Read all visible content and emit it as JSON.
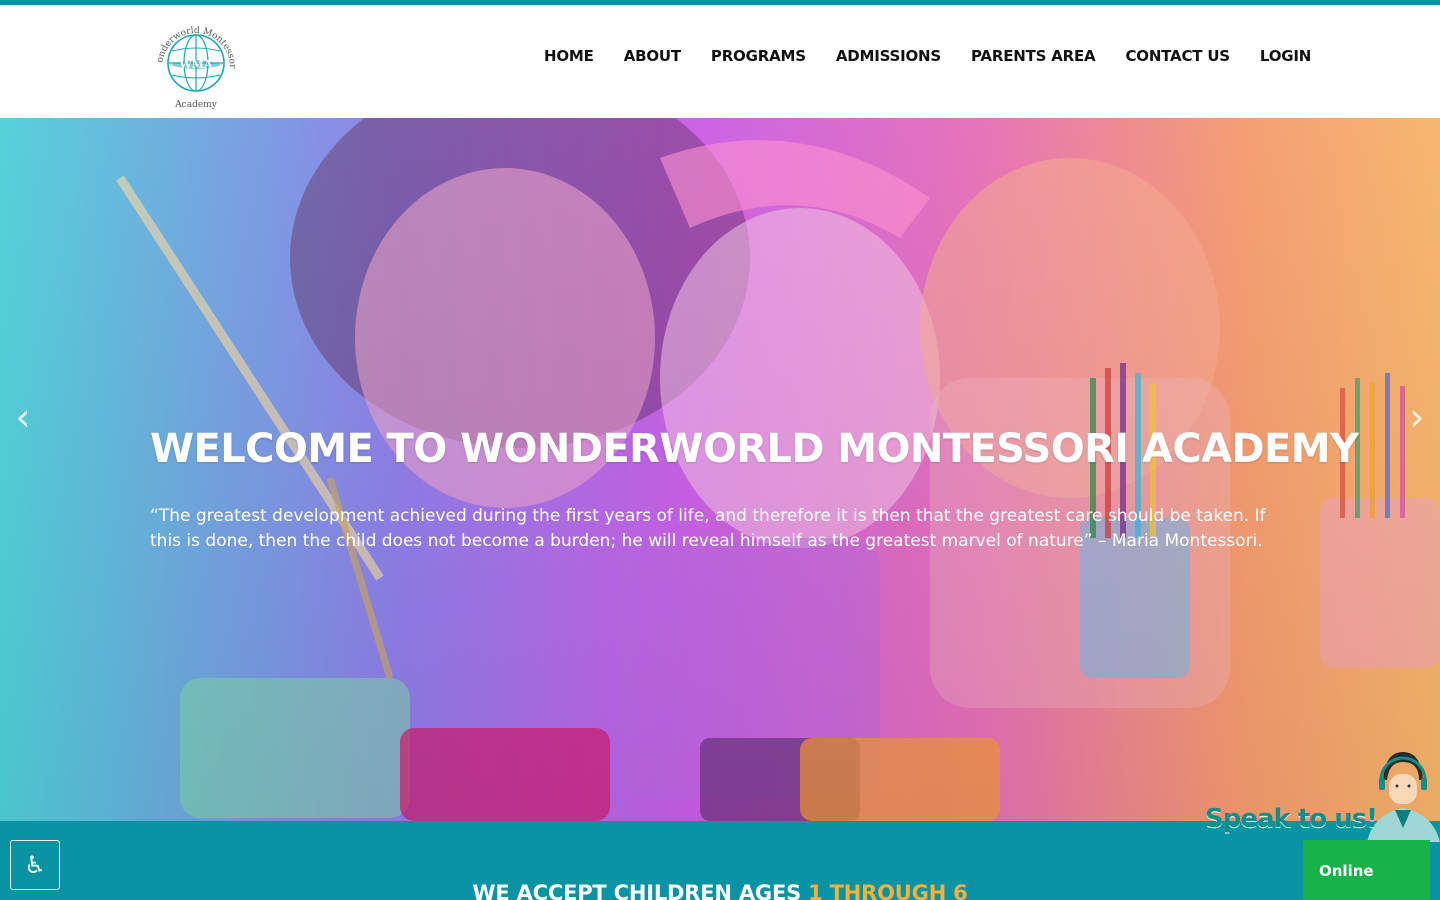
{
  "brand": {
    "logo_text_top": "Wonderworld Montessori",
    "logo_text_bottom": "Academy",
    "logo_monogram": "WMA",
    "colors": {
      "teal": "#0a93a3",
      "accent": "#f4b03a",
      "online": "#18b24a"
    }
  },
  "nav": {
    "items": [
      {
        "label": "HOME"
      },
      {
        "label": "ABOUT"
      },
      {
        "label": "PROGRAMS"
      },
      {
        "label": "ADMISSIONS"
      },
      {
        "label": "PARENTS AREA"
      },
      {
        "label": "CONTACT US"
      },
      {
        "label": "LOGIN"
      }
    ]
  },
  "hero": {
    "title": "WELCOME TO WONDERWORLD MONTESSORI ACADEMY",
    "quote": "“The greatest development achieved during the first years of life, and therefore it is then that the greatest care should be taken. If this is done, then the child does not become a burden; he will reveal himself as the greatest marvel of nature” – Maria Montessori.",
    "prev_icon": "chevron-left-icon",
    "next_icon": "chevron-right-icon",
    "prev_glyph": "‹",
    "next_glyph": "›"
  },
  "band": {
    "title_main": "WE ACCEPT CHILDREN AGES ",
    "title_accent": "1 THROUGH 6"
  },
  "widgets": {
    "accessibility_icon": "wheelchair-icon",
    "accessibility_glyph": "♿",
    "speak_label": "Speak to us!",
    "online_label": "Online"
  }
}
